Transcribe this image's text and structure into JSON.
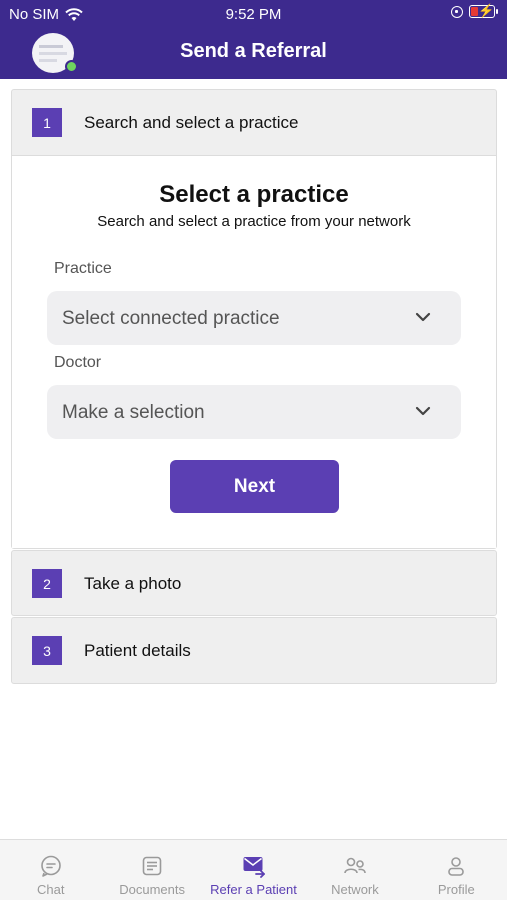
{
  "status_bar": {
    "carrier": "No SIM",
    "time": "9:52 PM"
  },
  "header": {
    "title": "Send a Referral"
  },
  "steps": [
    {
      "number": "1",
      "title": "Search and select a practice"
    },
    {
      "number": "2",
      "title": "Take a photo"
    },
    {
      "number": "3",
      "title": "Patient details"
    }
  ],
  "panel": {
    "title": "Select a practice",
    "subtitle": "Search and select a practice from your network",
    "practice_label": "Practice",
    "practice_value": "Select connected practice",
    "doctor_label": "Doctor",
    "doctor_value": "Make a selection",
    "next_label": "Next"
  },
  "tabs": [
    {
      "label": "Chat",
      "icon": "chat-icon",
      "active": false
    },
    {
      "label": "Documents",
      "icon": "documents-icon",
      "active": false
    },
    {
      "label": "Refer a Patient",
      "icon": "refer-icon",
      "active": true
    },
    {
      "label": "Network",
      "icon": "network-icon",
      "active": false
    },
    {
      "label": "Profile",
      "icon": "profile-icon",
      "active": false
    }
  ],
  "colors": {
    "header_bg": "#3d2a8e",
    "accent": "#5b3fb3",
    "inactive_tab": "#9a9a9a"
  }
}
